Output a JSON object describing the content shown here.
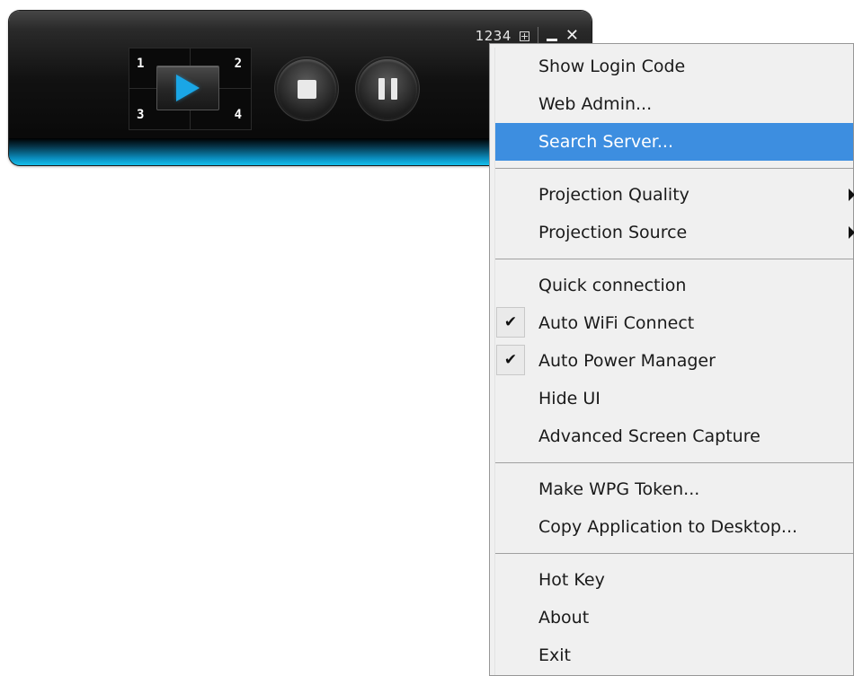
{
  "player": {
    "login_code": "1234",
    "quadrants": [
      "1",
      "2",
      "3",
      "4"
    ],
    "accent_color": "#16c0ec",
    "icons": {
      "layout": "layout-grid-icon",
      "minimize": "minimize-icon",
      "close": "close-icon",
      "play": "play-icon",
      "stop": "stop-icon",
      "pause": "pause-icon"
    }
  },
  "menu": {
    "highlight_color": "#3d8ee0",
    "groups": [
      [
        {
          "label": "Show Login Code"
        },
        {
          "label": "Web Admin..."
        },
        {
          "label": "Search Server...",
          "highlighted": true
        }
      ],
      [
        {
          "label": "Projection Quality",
          "submenu": true
        },
        {
          "label": "Projection Source",
          "submenu": true
        }
      ],
      [
        {
          "label": "Quick connection"
        },
        {
          "label": "Auto WiFi Connect",
          "checked": true
        },
        {
          "label": "Auto Power Manager",
          "checked": true
        },
        {
          "label": "Hide UI"
        },
        {
          "label": "Advanced Screen Capture"
        }
      ],
      [
        {
          "label": "Make WPG Token..."
        },
        {
          "label": "Copy Application to Desktop..."
        }
      ],
      [
        {
          "label": "Hot Key"
        },
        {
          "label": "About"
        },
        {
          "label": "Exit"
        }
      ]
    ]
  }
}
